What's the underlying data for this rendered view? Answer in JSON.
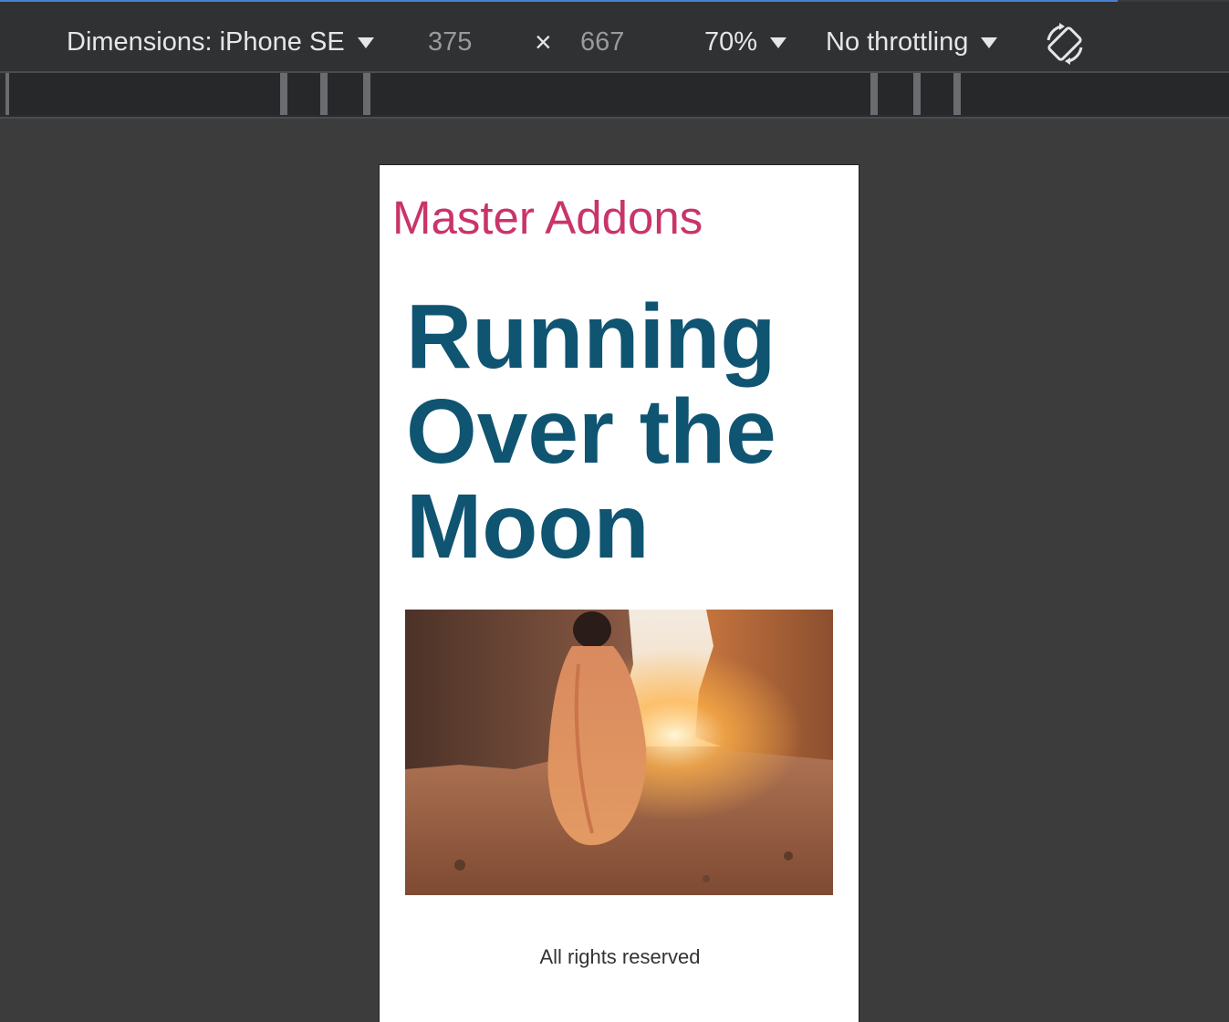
{
  "devtools": {
    "dimensions_label": "Dimensions: iPhone SE",
    "width_value": "375",
    "times_symbol": "×",
    "height_value": "667",
    "zoom": "70%",
    "throttling": "No throttling",
    "rotate_icon": "rotate-icon"
  },
  "page": {
    "site_title": "Master Addons",
    "headline_line1": "Running",
    "headline_line2": "Over the",
    "headline_line3": "Moon",
    "footer": "All rights reserved"
  },
  "colors": {
    "site_title": "#c9346a",
    "headline": "#0f5471",
    "devtools_bg": "#2f3133",
    "stage_bg": "#3c3c3c"
  }
}
